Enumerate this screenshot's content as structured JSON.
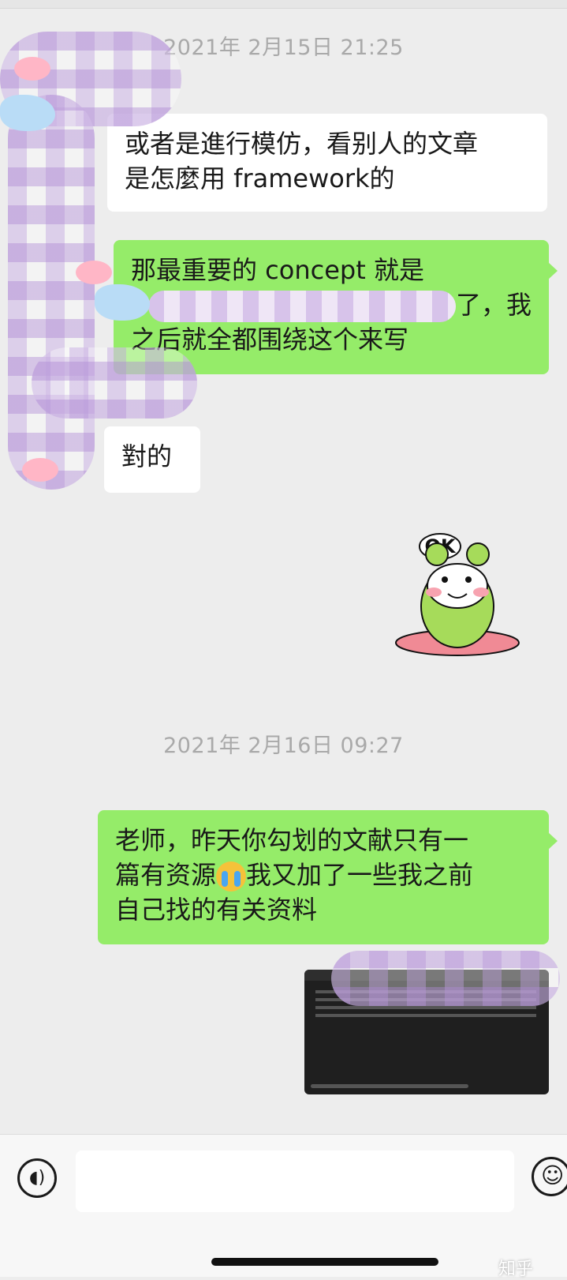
{
  "chat": {
    "timestamps": [
      "2021年 2月15日 21:25",
      "2021年 2月16日 09:27"
    ],
    "messages": [
      {
        "from": "in",
        "lines": [
          "或者是進行模仿，看别人的文章",
          "是怎麼用 framework的"
        ]
      },
      {
        "from": "out",
        "lines": [
          "那最重要的 concept 就是",
          "了，我",
          "之后就全都围绕这个来写"
        ]
      },
      {
        "from": "in",
        "lines": [
          "對的"
        ]
      },
      {
        "from": "out",
        "sticker_text": "OK"
      },
      {
        "from": "out",
        "lines": [
          "老师，昨天你勾划的文献只有一",
          "篇有资源",
          "我又加了一些我之前",
          "自己找的有关资料"
        ]
      },
      {
        "from": "out",
        "image": "screenshot-thumbnail"
      }
    ]
  },
  "input_bar": {
    "voice_icon": "voice-icon",
    "emoji_icon": "emoji-icon",
    "value": ""
  },
  "watermark": "知乎",
  "colors": {
    "background": "#ededed",
    "outgoing": "#95ec69",
    "incoming": "#ffffff"
  }
}
